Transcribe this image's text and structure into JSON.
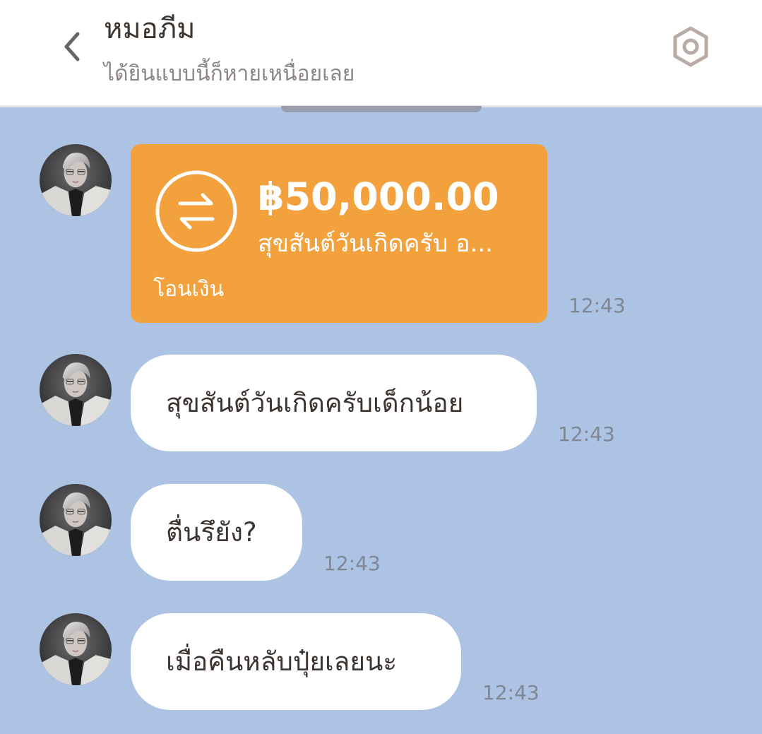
{
  "header": {
    "back_icon": "chevron-left-icon",
    "title": "หมอภีม",
    "subtitle": "ได้ยินแบบนี้ก็หายเหนื่อยเลย",
    "settings_icon": "hexagon-settings-icon"
  },
  "colors": {
    "chat_background": "#adc3e3",
    "transfer_card": "#f3a13d",
    "bubble": "#ffffff",
    "text": "#3c3430",
    "timestamp": "#7f8694"
  },
  "messages": [
    {
      "type": "transfer",
      "icon": "transfer-arrows-icon",
      "amount": "฿50,000.00",
      "note": "สุขสันต์วันเกิดครับ อ...",
      "kind": "โอนเงิน",
      "time": "12:43"
    },
    {
      "type": "text",
      "text": "สุขสันต์วันเกิดครับเด็กน้อย",
      "time": "12:43"
    },
    {
      "type": "text",
      "text": "ตื่นรึยัง?",
      "time": "12:43"
    },
    {
      "type": "text",
      "text": "เมื่อคืนหลับปุ๋ยเลยนะ",
      "time": "12:43"
    }
  ]
}
